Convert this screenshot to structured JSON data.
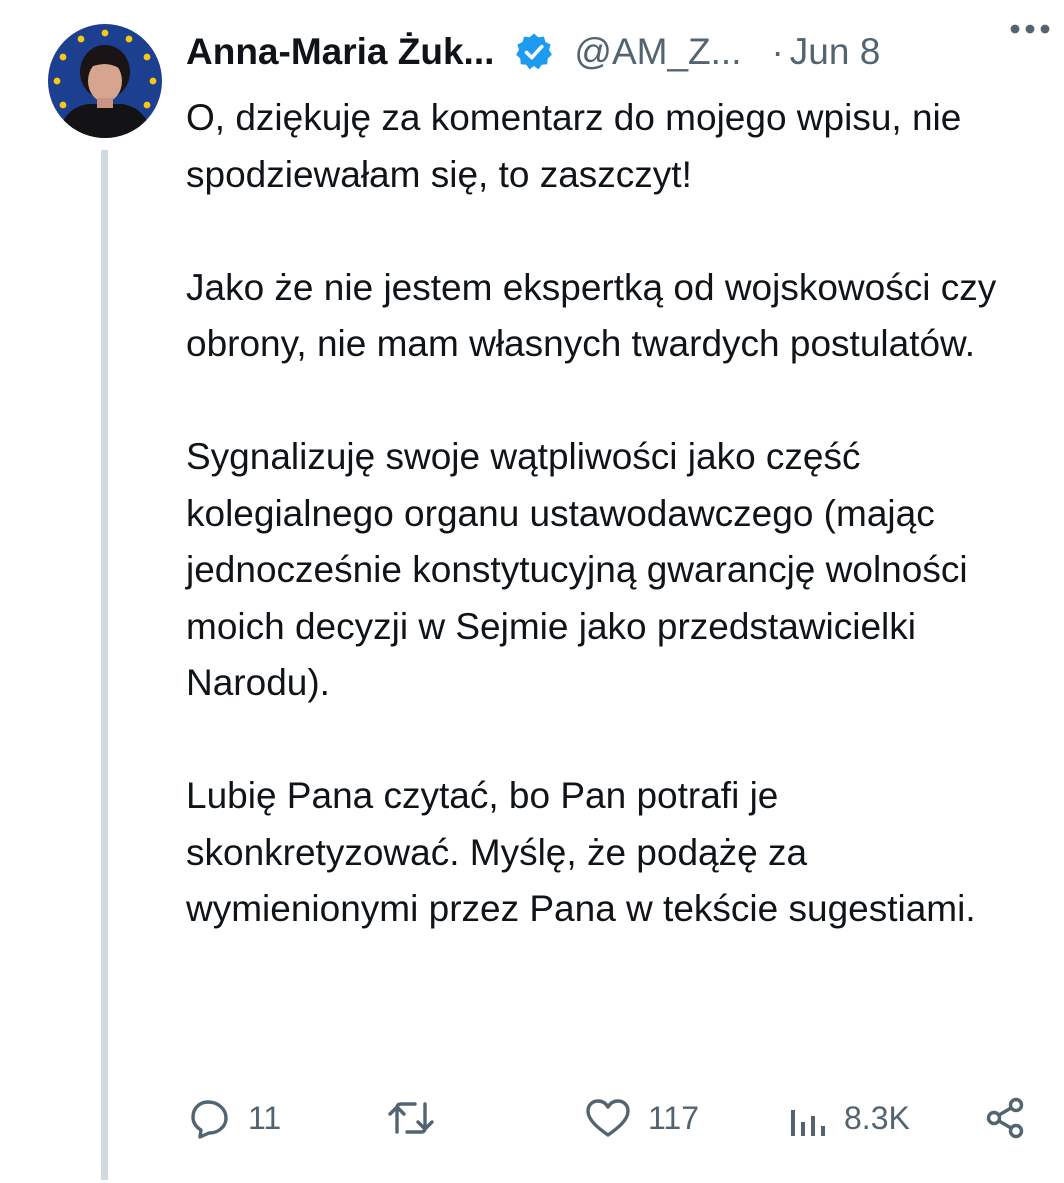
{
  "tweet": {
    "author_name": "Anna-Maria Żuk...",
    "handle": "@AM_Z...",
    "separator": "·",
    "date": "Jun 8",
    "paragraphs": [
      "O, dziękuję za komentarz do mojego wpisu, nie spodziewałam się, to zaszczyt!",
      "Jako że nie jestem ekspertką od wojskowości czy obrony, nie mam własnych twardych postulatów.",
      "Sygnalizuję swoje wątpliwości jako część kolegialnego organu ustawodawczego (mając jednocześnie konstytucyjną gwarancję wolności moich decyzji w Sejmie jako przedstawicielki Narodu).",
      "Lubię Pana czytać, bo Pan potrafi je skonkretyzować. Myślę, że podążę za wymienionymi przez Pana w tekście sugestiami."
    ],
    "stats": {
      "replies": "11",
      "retweets": "",
      "likes": "117",
      "views": "8.3K"
    }
  },
  "icons": {
    "verified": "verified-badge-icon",
    "more": "more-options-icon",
    "reply": "reply-icon",
    "retweet": "retweet-icon",
    "like": "heart-icon",
    "views": "views-chart-icon",
    "share": "share-icon"
  },
  "colors": {
    "text": "#0f1419",
    "secondary": "#536471",
    "verified": "#1d9bf0",
    "thread_line": "#cfd9de",
    "avatar_background": "#1c3f8f",
    "avatar_stars": "#f6c913"
  }
}
